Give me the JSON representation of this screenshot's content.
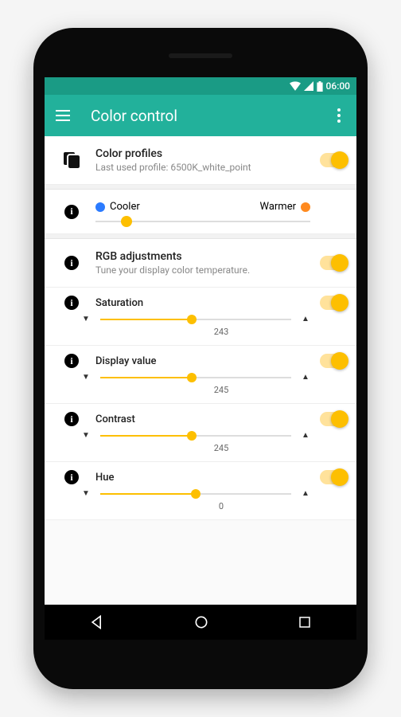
{
  "status": {
    "time": "06:00"
  },
  "appbar": {
    "title": "Color control"
  },
  "profiles": {
    "title": "Color profiles",
    "subtitle": "Last used profile: 6500K_white_point"
  },
  "temperature": {
    "cool_label": "Cooler",
    "warm_label": "Warmer",
    "position_pct": 12
  },
  "rgb": {
    "title": "RGB adjustments",
    "subtitle": "Tune your display color temperature."
  },
  "sliders": [
    {
      "label": "Saturation",
      "value": "243",
      "pct": 48
    },
    {
      "label": "Display value",
      "value": "245",
      "pct": 48
    },
    {
      "label": "Contrast",
      "value": "245",
      "pct": 48
    },
    {
      "label": "Hue",
      "value": "0",
      "pct": 50
    }
  ]
}
